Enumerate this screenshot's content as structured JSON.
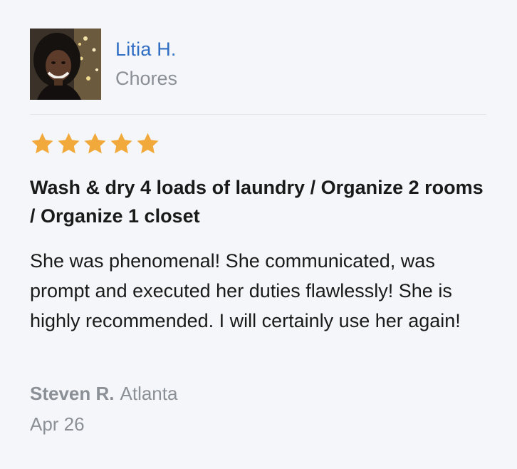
{
  "tasker": {
    "name": "Litia H.",
    "category": "Chores"
  },
  "review": {
    "rating": 5,
    "max_rating": 5,
    "star_color": "#f2a93b",
    "title": "Wash & dry 4 loads of laundry / Organize 2 rooms / Organize 1 closet",
    "body": "She was phenomenal! She communicated, was prompt and executed her duties flawlessly! She is highly recommended. I will certainly use her again!",
    "reviewer_name": "Steven R.",
    "reviewer_location": "Atlanta",
    "date": "Apr 26"
  },
  "colors": {
    "link": "#2f6ec2",
    "muted": "#8b9097",
    "text": "#1a1a1a",
    "background": "#f5f6f9"
  }
}
